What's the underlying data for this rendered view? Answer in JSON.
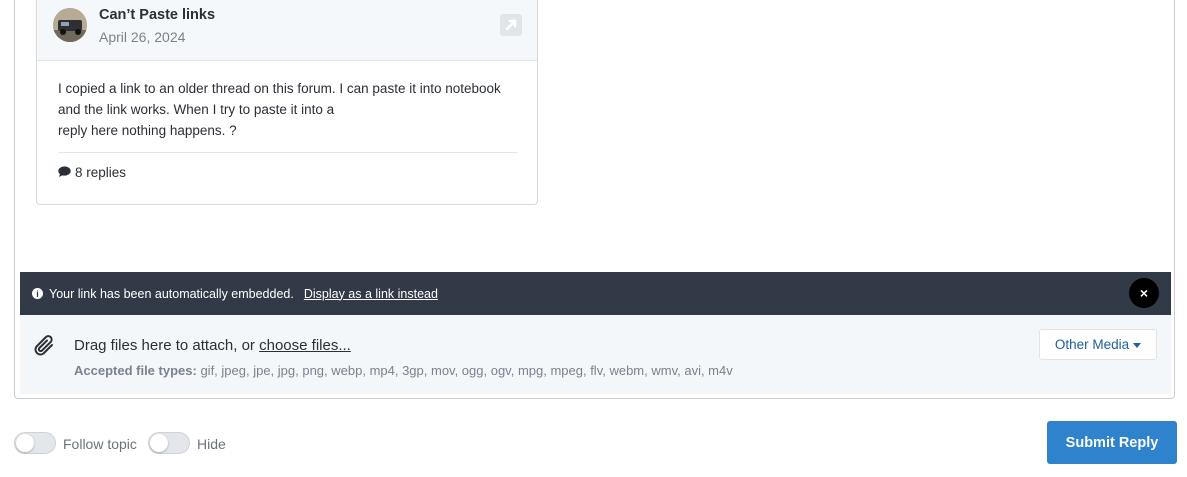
{
  "embed": {
    "title": "Can’t Paste links",
    "date": "April 26, 2024",
    "body_lines": [
      "I copied a link to an older thread on this forum. I can paste it into notebook",
      "and the link works. When I try to paste it into a",
      "reply here nothing happens. ?"
    ],
    "replies": "8 replies",
    "icons": {
      "avatar": "user-avatar",
      "external": "external-link-icon",
      "replies": "comment-icon"
    }
  },
  "notice": {
    "text": "Your link has been automatically embedded.",
    "link": "Display as a link instead",
    "close": "×",
    "info_icon_glyph": "i"
  },
  "attach": {
    "drag_text": "Drag files here to attach, or",
    "choose_link": "choose files...",
    "accepted_label": "Accepted file types:",
    "accepted_types": "gif, jpeg, jpe, jpg, png, webp, mp4, 3gp, mov, ogg, ogv, mpg, mpeg, flv, webm, wmv, avi, m4v",
    "other_media": "Other Media"
  },
  "footer": {
    "follow_label": "Follow topic",
    "hide_label": "Hide",
    "submit_label": "Submit Reply"
  },
  "colors": {
    "notice_bg": "#323a48",
    "submit_bg": "#2e83cc",
    "link_blue": "#1f5f99"
  }
}
